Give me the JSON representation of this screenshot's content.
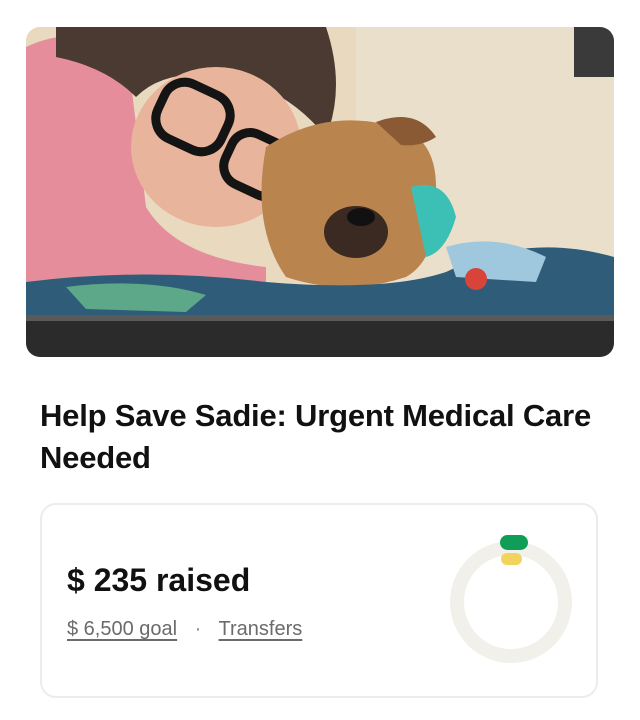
{
  "campaign": {
    "title": "Help Save Sadie: Urgent Medical Care Needed"
  },
  "progress": {
    "raised_text": "$ 235 raised",
    "goal_text": "$ 6,500 goal",
    "separator": "·",
    "transfers_label": "Transfers",
    "fraction": 0.036,
    "colors": {
      "track": "#f1f0eb",
      "green": "#0f9d58",
      "yellow": "#f2d45c"
    }
  }
}
